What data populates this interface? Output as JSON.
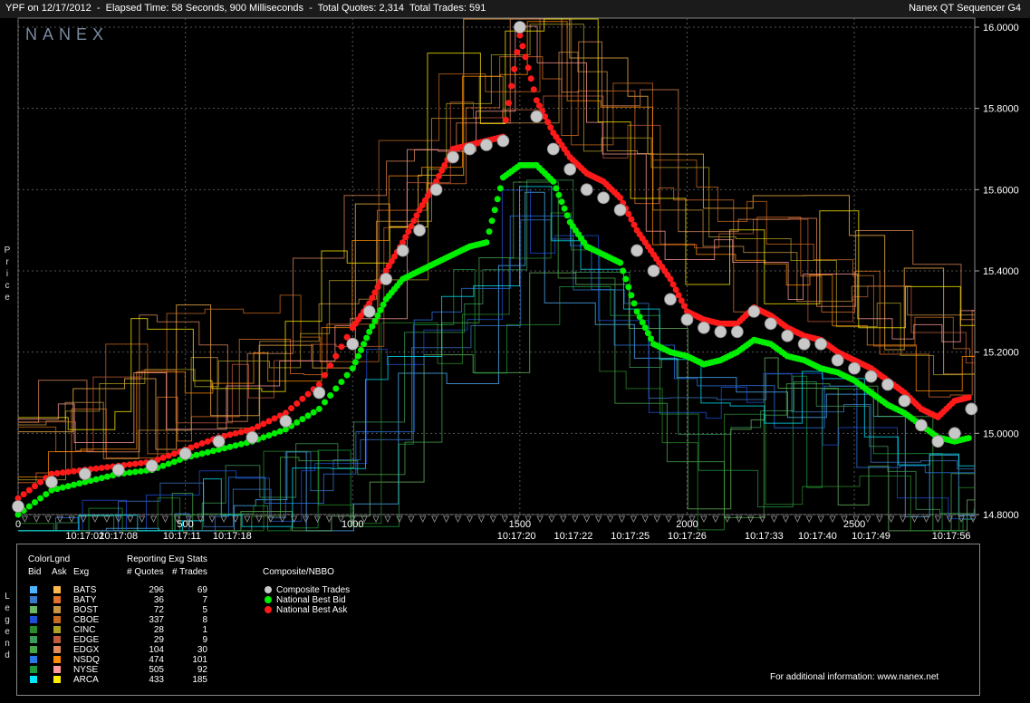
{
  "header": {
    "title": "YPF on 12/17/2012  -  Elapsed Time: 58 Seconds, 900 Milliseconds  -  Total Quotes: 2,314  Total Trades: 591",
    "app_name": "Nanex QT Sequencer G4"
  },
  "watermark": "NANEX",
  "side_labels": {
    "price": "Price",
    "legend": "Legend"
  },
  "colors": {
    "background": "#000000",
    "grid": "#555555",
    "composite_trades": "#c8c8c8",
    "national_best_bid": "#00ee00",
    "national_best_ask": "#ff1a1a"
  },
  "chart_data": {
    "type": "line",
    "x_axis": {
      "range": [
        0,
        2860
      ],
      "ticks": [
        0,
        500,
        1000,
        1500,
        2000,
        2500
      ],
      "time_labels": [
        {
          "x": 200,
          "label": "10:17:02"
        },
        {
          "x": 300,
          "label": "10:17:08"
        },
        {
          "x": 490,
          "label": "10:17:11"
        },
        {
          "x": 640,
          "label": "10:17:18"
        },
        {
          "x": 1490,
          "label": "10:17:20"
        },
        {
          "x": 1660,
          "label": "10:17:22"
        },
        {
          "x": 1830,
          "label": "10:17:25"
        },
        {
          "x": 2000,
          "label": "10:17:26"
        },
        {
          "x": 2230,
          "label": "10:17:33"
        },
        {
          "x": 2390,
          "label": "10:17:40"
        },
        {
          "x": 2550,
          "label": "10:17:49"
        },
        {
          "x": 2790,
          "label": "10:17:56"
        }
      ]
    },
    "y_axis": {
      "label": "Price",
      "range": [
        14.8,
        16.0
      ],
      "ticks": [
        14.8,
        15.0,
        15.2,
        15.4,
        15.6,
        15.8,
        16.0
      ],
      "tick_labels": [
        "14.8000",
        "15.0000",
        "15.2000",
        "15.4000",
        "15.6000",
        "15.8000",
        "16.0000"
      ]
    },
    "grid": true,
    "series": [
      {
        "name": "Composite Trades",
        "color": "#c8c8c8",
        "x": [
          0,
          100,
          200,
          300,
          400,
          500,
          600,
          700,
          800,
          900,
          1000,
          1050,
          1100,
          1150,
          1200,
          1250,
          1300,
          1350,
          1400,
          1450,
          1500,
          1550,
          1600,
          1650,
          1700,
          1750,
          1800,
          1850,
          1900,
          1950,
          2000,
          2050,
          2100,
          2150,
          2200,
          2250,
          2300,
          2350,
          2400,
          2450,
          2500,
          2550,
          2600,
          2650,
          2700,
          2750,
          2800,
          2850
        ],
        "y": [
          14.82,
          14.88,
          14.9,
          14.91,
          14.92,
          14.95,
          14.98,
          14.99,
          15.03,
          15.1,
          15.22,
          15.3,
          15.38,
          15.45,
          15.5,
          15.6,
          15.68,
          15.7,
          15.71,
          15.72,
          16.0,
          15.78,
          15.7,
          15.65,
          15.6,
          15.58,
          15.55,
          15.45,
          15.4,
          15.33,
          15.28,
          15.26,
          15.25,
          15.25,
          15.3,
          15.27,
          15.24,
          15.22,
          15.22,
          15.18,
          15.16,
          15.14,
          15.12,
          15.08,
          15.02,
          14.98,
          15.0,
          15.06
        ]
      },
      {
        "name": "National Best Bid",
        "color": "#00ee00",
        "x": [
          0,
          100,
          200,
          300,
          400,
          500,
          600,
          700,
          800,
          900,
          1000,
          1050,
          1100,
          1150,
          1200,
          1250,
          1300,
          1350,
          1400,
          1450,
          1500,
          1550,
          1600,
          1650,
          1700,
          1750,
          1800,
          1850,
          1900,
          1950,
          2000,
          2050,
          2100,
          2150,
          2200,
          2250,
          2300,
          2350,
          2400,
          2450,
          2500,
          2550,
          2600,
          2650,
          2700,
          2750,
          2800,
          2850
        ],
        "y": [
          14.8,
          14.86,
          14.88,
          14.9,
          14.91,
          14.94,
          14.96,
          14.98,
          15.01,
          15.06,
          15.16,
          15.25,
          15.33,
          15.38,
          15.4,
          15.42,
          15.44,
          15.46,
          15.47,
          15.63,
          15.66,
          15.66,
          15.62,
          15.52,
          15.46,
          15.44,
          15.42,
          15.3,
          15.22,
          15.2,
          15.19,
          15.17,
          15.18,
          15.2,
          15.23,
          15.22,
          15.19,
          15.18,
          15.16,
          15.15,
          15.13,
          15.1,
          15.07,
          15.05,
          15.02,
          14.99,
          14.98,
          14.99
        ]
      },
      {
        "name": "National Best Ask",
        "color": "#ff1a1a",
        "x": [
          0,
          100,
          200,
          300,
          400,
          500,
          600,
          700,
          800,
          900,
          1000,
          1050,
          1100,
          1150,
          1200,
          1250,
          1300,
          1350,
          1400,
          1450,
          1500,
          1550,
          1600,
          1650,
          1700,
          1750,
          1800,
          1850,
          1900,
          1950,
          2000,
          2050,
          2100,
          2150,
          2200,
          2250,
          2300,
          2350,
          2400,
          2450,
          2500,
          2550,
          2600,
          2650,
          2700,
          2750,
          2800,
          2850
        ],
        "y": [
          14.84,
          14.9,
          14.91,
          14.92,
          14.93,
          14.96,
          14.99,
          15.01,
          15.05,
          15.12,
          15.26,
          15.32,
          15.4,
          15.47,
          15.55,
          15.62,
          15.7,
          15.71,
          15.72,
          15.73,
          15.98,
          15.82,
          15.74,
          15.68,
          15.64,
          15.62,
          15.58,
          15.5,
          15.44,
          15.38,
          15.3,
          15.28,
          15.27,
          15.27,
          15.31,
          15.29,
          15.26,
          15.24,
          15.23,
          15.2,
          15.18,
          15.16,
          15.13,
          15.1,
          15.06,
          15.04,
          15.08,
          15.09
        ]
      }
    ]
  },
  "legend": {
    "color_legend_title": "ColorLgnd",
    "bid_header": "Bid",
    "ask_header": "Ask",
    "exg_header": "Exg",
    "stats_title": "Reporting Exg Stats",
    "quotes_header": "# Quotes",
    "trades_header": "# Trades",
    "composite_title": "Composite/NBBO",
    "exchanges": [
      {
        "name": "BATS",
        "quotes": "296",
        "trades": "69",
        "bid_color": "#4fb4ff",
        "ask_color": "#ffb84a"
      },
      {
        "name": "BATY",
        "quotes": "36",
        "trades": "7",
        "bid_color": "#3a78c8",
        "ask_color": "#e0702a"
      },
      {
        "name": "BOST",
        "quotes": "72",
        "trades": "5",
        "bid_color": "#6ab860",
        "ask_color": "#c89640"
      },
      {
        "name": "CBOE",
        "quotes": "337",
        "trades": "8",
        "bid_color": "#1f4fd8",
        "ask_color": "#c86a1e"
      },
      {
        "name": "CINC",
        "quotes": "28",
        "trades": "1",
        "bid_color": "#2a8a2a",
        "ask_color": "#b0a020"
      },
      {
        "name": "EDGE",
        "quotes": "29",
        "trades": "9",
        "bid_color": "#3c9a5a",
        "ask_color": "#c05a3a"
      },
      {
        "name": "EDGX",
        "quotes": "104",
        "trades": "30",
        "bid_color": "#48a848",
        "ask_color": "#e08a5a"
      },
      {
        "name": "NSDQ",
        "quotes": "474",
        "trades": "101",
        "bid_color": "#2a78e8",
        "ask_color": "#ff8c00"
      },
      {
        "name": "NYSE",
        "quotes": "505",
        "trades": "92",
        "bid_color": "#1e9a3a",
        "ask_color": "#ff9a9a"
      },
      {
        "name": "ARCA",
        "quotes": "433",
        "trades": "185",
        "bid_color": "#00e8ff",
        "ask_color": "#ffee00"
      }
    ],
    "composite_items": [
      {
        "label": "Composite Trades",
        "color": "#c8c8c8"
      },
      {
        "label": "National Best Bid",
        "color": "#00ee00"
      },
      {
        "label": "National Best Ask",
        "color": "#ff1a1a"
      }
    ],
    "footer": "For additional information: www.nanex.net"
  }
}
